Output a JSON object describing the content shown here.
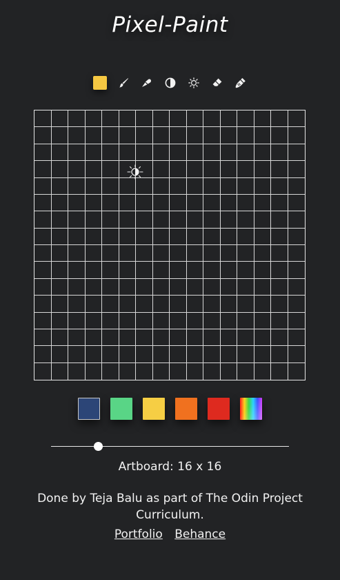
{
  "app": {
    "title": "Pixel-Paint"
  },
  "toolbar": {
    "current_color": "#f6c842",
    "tools": [
      {
        "name": "color-swatch-icon"
      },
      {
        "name": "brush-icon"
      },
      {
        "name": "fill-icon"
      },
      {
        "name": "shade-icon"
      },
      {
        "name": "lighten-icon"
      },
      {
        "name": "eraser-icon"
      },
      {
        "name": "clear-icon"
      }
    ]
  },
  "board": {
    "columns": 16,
    "rows": 16,
    "grid_color": "#d8d8d8",
    "cursor_icon": "shade-icon"
  },
  "palette": {
    "swatches": [
      {
        "name": "blue",
        "color": "#2c4577"
      },
      {
        "name": "green",
        "color": "#59d586"
      },
      {
        "name": "yellow",
        "color": "#f6ce44"
      },
      {
        "name": "orange",
        "color": "#f0711f"
      },
      {
        "name": "red",
        "color": "#de2a1f"
      },
      {
        "name": "rainbow",
        "color": "gradient"
      }
    ]
  },
  "slider": {
    "value": 16,
    "min": 2,
    "max": 100
  },
  "artboard": {
    "label": "Artboard: 16 x 16"
  },
  "footer": {
    "credit": "Done by Teja Balu as part of The Odin Project Curriculum.",
    "portfolio_label": "Portfolio",
    "behance_label": "Behance"
  }
}
